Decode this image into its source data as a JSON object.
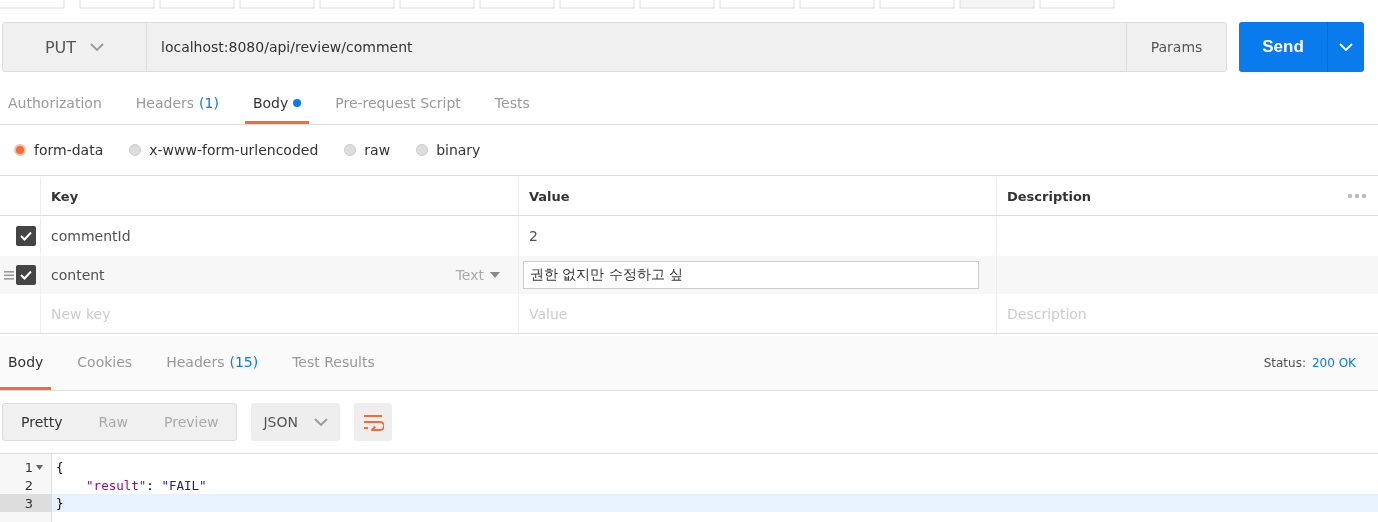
{
  "request": {
    "method": "PUT",
    "url": "localhost:8080/api/review/comment",
    "params_button": "Params",
    "send_button": "Send"
  },
  "request_tabs": [
    {
      "label": "Authorization",
      "selected": false
    },
    {
      "label": "Headers",
      "count": "(1)",
      "selected": false
    },
    {
      "label": "Body",
      "dot": true,
      "selected": true
    },
    {
      "label": "Pre-request Script",
      "selected": false
    },
    {
      "label": "Tests",
      "selected": false
    }
  ],
  "body_modes": [
    {
      "label": "form-data",
      "selected": true
    },
    {
      "label": "x-www-form-urlencoded",
      "selected": false
    },
    {
      "label": "raw",
      "selected": false
    },
    {
      "label": "binary",
      "selected": false
    }
  ],
  "params_table": {
    "columns": [
      "Key",
      "Value",
      "Description"
    ],
    "rows": [
      {
        "checked": true,
        "key": "commentId",
        "value": "2",
        "hovered": false
      },
      {
        "checked": true,
        "key": "content",
        "type": "Text",
        "value": "권한 없지만 수정하고 싶",
        "hovered": true
      }
    ],
    "new_row": {
      "key_placeholder": "New key",
      "value_placeholder": "Value",
      "description_placeholder": "Description"
    }
  },
  "response_tabs": [
    {
      "label": "Body",
      "selected": true
    },
    {
      "label": "Cookies",
      "selected": false
    },
    {
      "label": "Headers",
      "count": "(15)",
      "selected": false
    },
    {
      "label": "Test Results",
      "selected": false
    }
  ],
  "status": {
    "label": "Status:",
    "value": "200 OK"
  },
  "view_modes": [
    {
      "label": "Pretty",
      "selected": true
    },
    {
      "label": "Raw",
      "selected": false
    },
    {
      "label": "Preview",
      "selected": false
    }
  ],
  "format": "JSON",
  "code": [
    {
      "number": "1",
      "foldable": true,
      "current": false,
      "tokens": [
        {
          "kind": "punct",
          "text": "{"
        }
      ]
    },
    {
      "number": "2",
      "foldable": false,
      "current": false,
      "tokens": [
        {
          "kind": "key",
          "text": "\"result\""
        },
        {
          "kind": "punct",
          "text": ": "
        },
        {
          "kind": "string",
          "text": "\"FAIL\""
        }
      ]
    },
    {
      "number": "3",
      "foldable": false,
      "current": true,
      "tokens": [
        {
          "kind": "punct",
          "text": "}"
        }
      ]
    }
  ]
}
